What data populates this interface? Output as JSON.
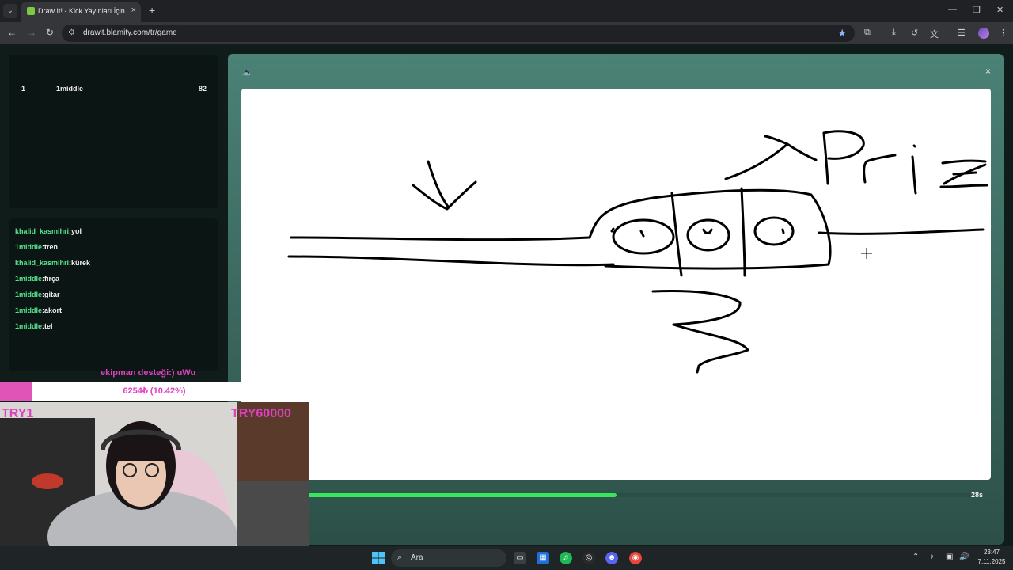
{
  "browser": {
    "tab_title": "Draw It! - Kick Yayınları İçin Çizim",
    "url": "drawit.blamity.com/tr/game",
    "tab_close": "×",
    "new_tab": "+",
    "window_minimize": "—",
    "window_restore": "❐",
    "window_close": "✕"
  },
  "scoreboard": {
    "rows": [
      {
        "rank": "1",
        "name": "1middle",
        "points": "82"
      }
    ]
  },
  "chat": {
    "messages": [
      {
        "user": "khalid_kasmihri",
        "text": ":yol"
      },
      {
        "user": "1middle",
        "text": ":tren"
      },
      {
        "user": "khalid_kasmihri",
        "text": ":kürek"
      },
      {
        "user": "1middle",
        "text": ":fırça"
      },
      {
        "user": "1middle",
        "text": ":gitar"
      },
      {
        "user": "1middle",
        "text": ":akort"
      },
      {
        "user": "1middle",
        "text": ":tel"
      }
    ]
  },
  "game": {
    "timer_text": "28s",
    "timer_progress": 0.46,
    "close_label": "×"
  },
  "stream_goal": {
    "title": "ekipman desteği:) uWu",
    "amount": "6254₺ (10.42%)",
    "progress": 0.1042,
    "start_label": "TRY1",
    "end_label": "TRY60000"
  },
  "taskbar": {
    "search_label": "Ara",
    "time": "23:47",
    "date": "7.11.2025"
  },
  "colors": {
    "accent_green": "#37e65c",
    "chat_user": "#54e58e",
    "goal_pink": "#e040c0"
  }
}
